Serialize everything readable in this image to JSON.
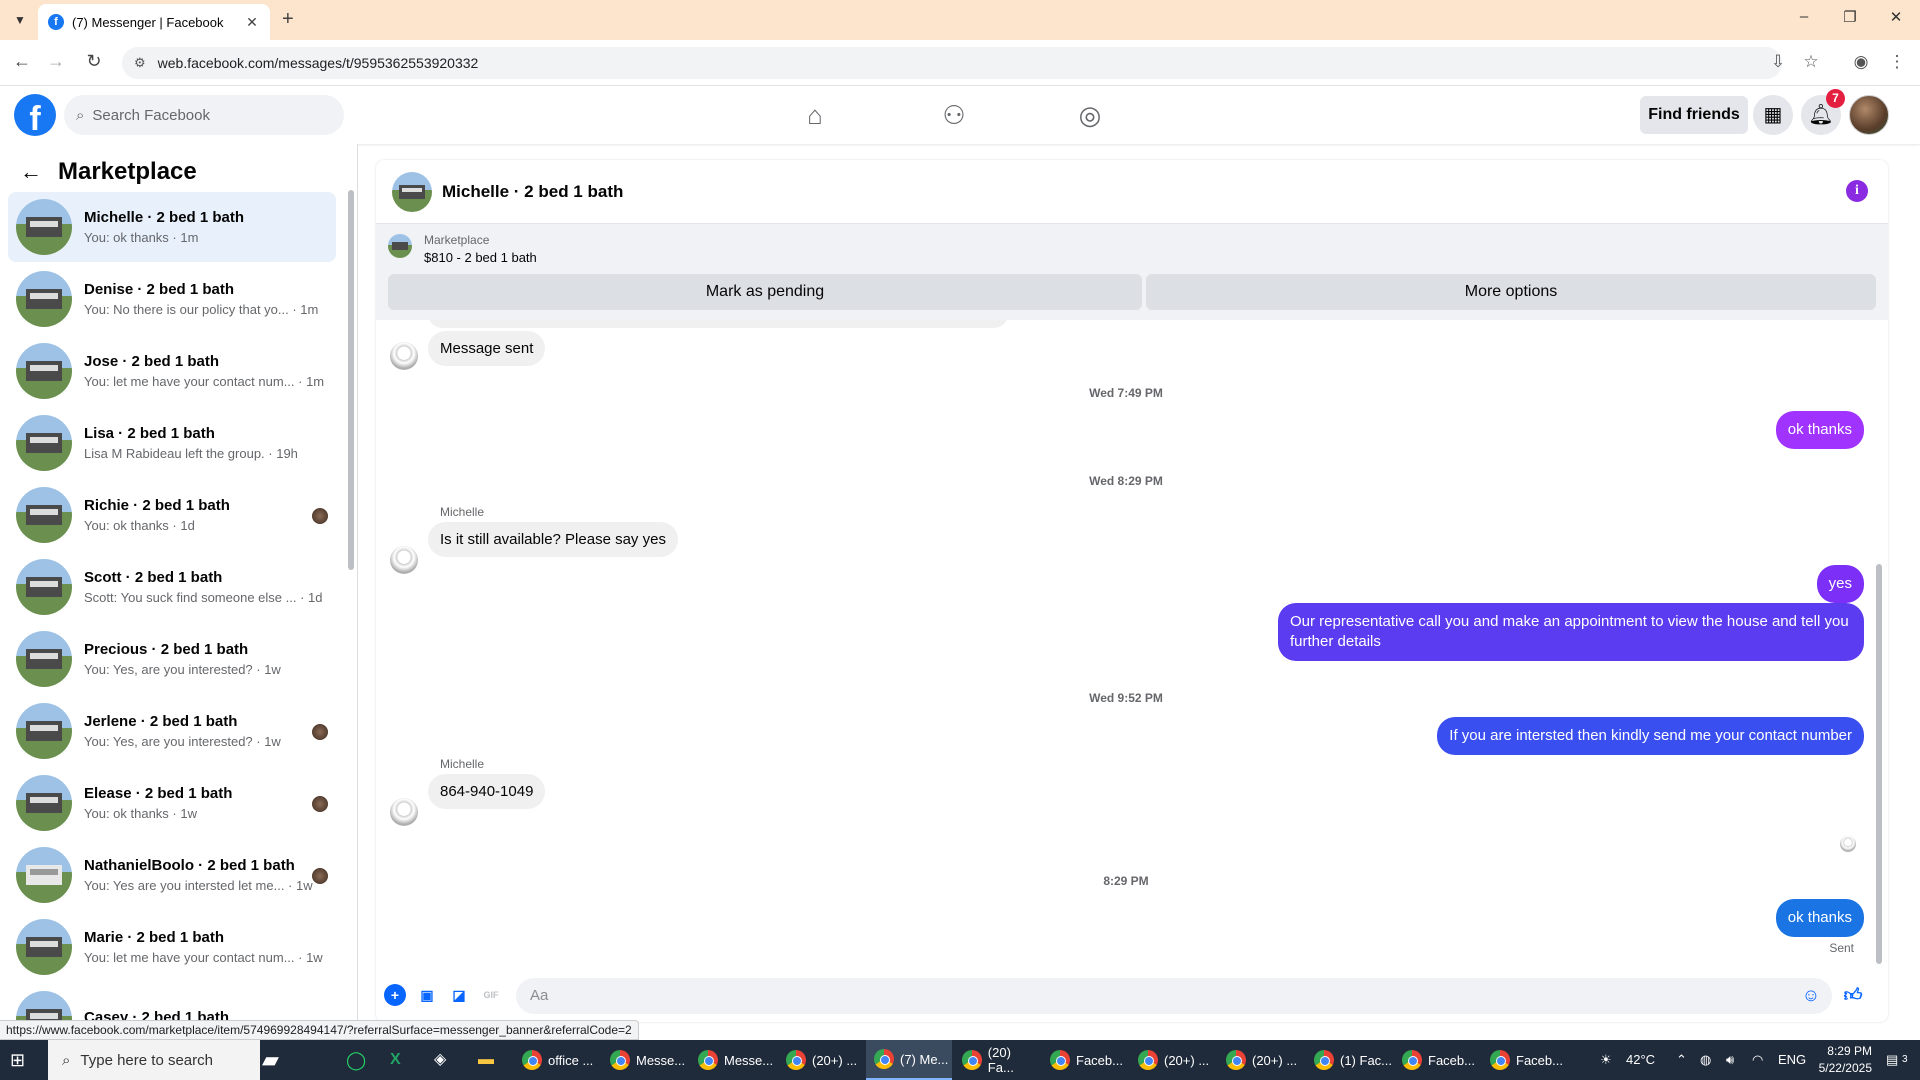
{
  "browser": {
    "tab_title": "(7) Messenger | Facebook",
    "tab_favicon": "f",
    "url": "web.facebook.com/messages/t/9595362553920332",
    "status_url": "https://www.facebook.com/marketplace/item/574969928494147/?referralSurface=messenger_banner&referralCode=2"
  },
  "fb": {
    "logo": "f",
    "search_placeholder": "Search Facebook",
    "find_friends": "Find friends",
    "notifications_count": "7"
  },
  "sidebar": {
    "title": "Marketplace",
    "conversations": [
      {
        "name": "Michelle · 2 bed 1 bath",
        "snippet": "You: ok thanks · 1m",
        "active": true,
        "seen": false,
        "light": false
      },
      {
        "name": "Denise · 2 bed 1 bath",
        "snippet": "You: No there is our policy that yo... · 1m",
        "active": false,
        "seen": false,
        "light": false
      },
      {
        "name": "Jose · 2 bed 1 bath",
        "snippet": "You: let me have your contact num... · 1m",
        "active": false,
        "seen": false,
        "light": false
      },
      {
        "name": "Lisa · 2 bed 1 bath",
        "snippet": "Lisa M Rabideau left the group. · 19h",
        "active": false,
        "seen": false,
        "light": false
      },
      {
        "name": "Richie · 2 bed 1 bath",
        "snippet": "You: ok thanks · 1d",
        "active": false,
        "seen": true,
        "light": false
      },
      {
        "name": "Scott · 2 bed 1 bath",
        "snippet": "Scott: You suck find someone else ... · 1d",
        "active": false,
        "seen": false,
        "light": false
      },
      {
        "name": "Precious · 2 bed 1 bath",
        "snippet": "You: Yes, are you interested? · 1w",
        "active": false,
        "seen": false,
        "light": false
      },
      {
        "name": "Jerlene · 2 bed 1 bath",
        "snippet": "You: Yes, are you interested? · 1w",
        "active": false,
        "seen": true,
        "light": false
      },
      {
        "name": "Elease · 2 bed 1 bath",
        "snippet": "You: ok thanks · 1w",
        "active": false,
        "seen": true,
        "light": false
      },
      {
        "name": "NathanielBoolo · 2 bed 1 bath",
        "snippet": "You: Yes are you intersted let me... · 1w",
        "active": false,
        "seen": true,
        "light": true
      },
      {
        "name": "Marie · 2 bed 1 bath",
        "snippet": "You: let me have your contact num... · 1w",
        "active": false,
        "seen": false,
        "light": false
      },
      {
        "name": "Casey · 2 bed 1 bath",
        "snippet": "",
        "active": false,
        "seen": false,
        "light": false
      }
    ]
  },
  "chat": {
    "title": "Michelle · 2 bed 1 bath",
    "marketplace_label": "Marketplace",
    "listing": "$810 - 2 bed 1 bath",
    "mark_pending": "Mark as pending",
    "more_options": "More options",
    "messages": {
      "m1": "Message sent",
      "ts1": "Wed 7:49 PM",
      "o1": "ok thanks",
      "ts2": "Wed 8:29 PM",
      "sender": "Michelle",
      "m2": "Is it still available? Please say yes",
      "o2": "yes",
      "o3": "Our representative  call you and make an appointment to view the house and tell you further details",
      "ts3": "Wed 9:52 PM",
      "o4": "If you are intersted  then kindly send me your contact number",
      "m3": "864-940-1049",
      "ts4": "8:29 PM",
      "o5": "ok thanks",
      "sent": "Sent"
    },
    "composer_placeholder": "Aa",
    "colors": {
      "purple": "#a033ff",
      "violet": "#7b2ff7",
      "indigo": "#5b3cf0",
      "blue": "#1b74e4"
    }
  },
  "taskbar": {
    "search_placeholder": "Type here to search",
    "items": [
      "office ...",
      "Messe...",
      "Messe...",
      "(20+) ...",
      "(7) Me...",
      "(20) Fa...",
      "Faceb...",
      "(20+) ...",
      "(20+) ...",
      "(1) Fac...",
      "Faceb...",
      "Faceb..."
    ],
    "weather": "42°C",
    "lang": "ENG",
    "time": "8:29 PM",
    "date": "5/22/2025",
    "notif": "3"
  }
}
